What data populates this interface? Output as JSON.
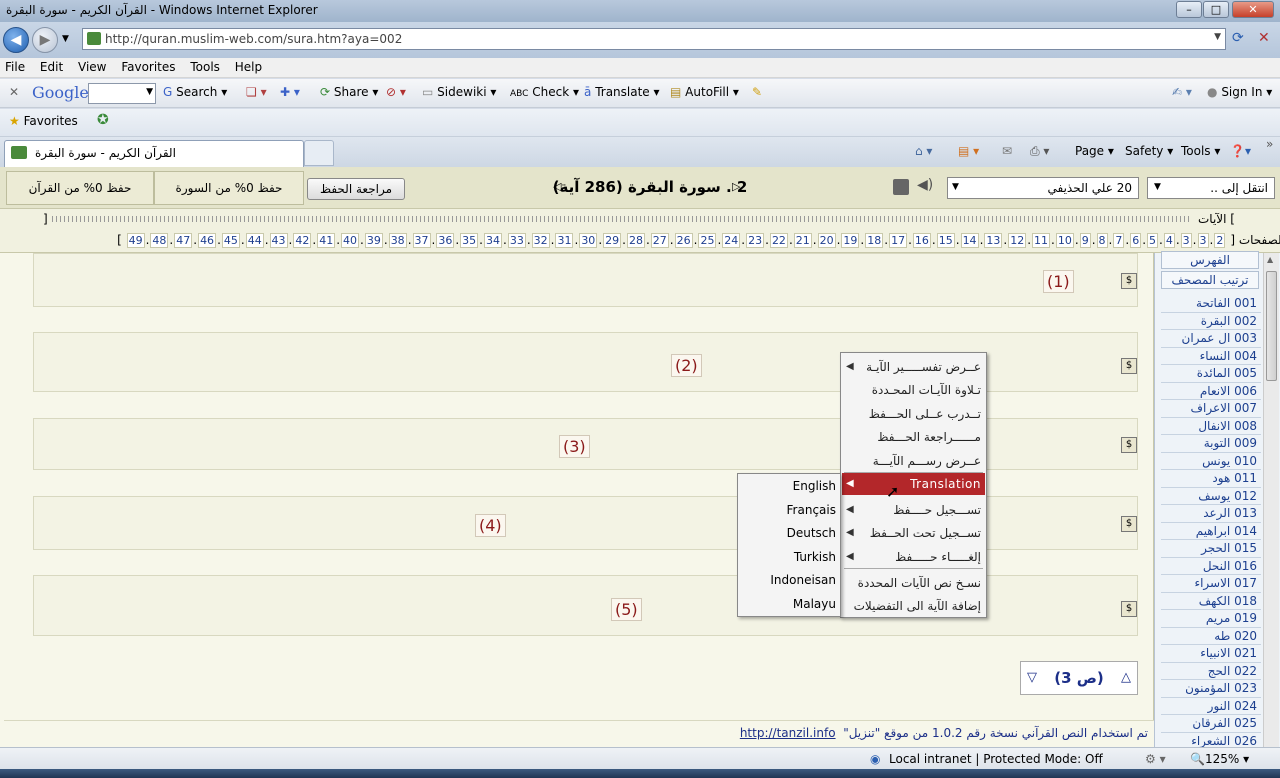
{
  "window": {
    "title": "القرآن الكريم - سورة البقرة - Windows Internet Explorer"
  },
  "browser": {
    "url": "http://quran.muslim-web.com/sura.htm?aya=002",
    "menu": [
      "File",
      "Edit",
      "View",
      "Favorites",
      "Tools",
      "Help"
    ],
    "google_toolbar": {
      "logo": "Google",
      "items": [
        "Search",
        "Share",
        "Sidewiki",
        "Check",
        "Translate",
        "AutoFill",
        "Sign In"
      ]
    },
    "favorites_label": "Favorites",
    "tab_title": "القرآن الكريم - سورة البقرة",
    "commands": [
      "Page",
      "Safety",
      "Tools"
    ]
  },
  "quran": {
    "header": {
      "juz_progress": "حفظ 0% من القرآن",
      "sura_progress": "حفظ 0% من السورة",
      "review_button": "مراجعة الحفظ",
      "sura_title": "2 . سورة البقرة (286 آية)",
      "reciter": "20 علي الحذيفي",
      "goto": "انتقل إلى .."
    },
    "ayat_label": "الآيات [",
    "ayat_end": "]",
    "pages_label": "الصفحات [",
    "pages_end": "]",
    "pages": [
      "2",
      "3",
      "3",
      "4",
      "5",
      "6",
      "7",
      "8",
      "9",
      "10",
      "11",
      "12",
      "13",
      "14",
      "15",
      "16",
      "17",
      "18",
      "19",
      "20",
      "21",
      "22",
      "23",
      "24",
      "25",
      "26",
      "27",
      "28",
      "29",
      "30",
      "31",
      "32",
      "33",
      "34",
      "35",
      "36",
      "37",
      "38",
      "39",
      "40",
      "41",
      "42",
      "43",
      "44",
      "45",
      "46",
      "47",
      "48",
      "49"
    ],
    "ayat": [
      "(1)",
      "(2)",
      "(3)",
      "(4)",
      "(5)"
    ],
    "page_nav": "(ص 3)",
    "footer_text": "تم استخدام النص القرآني نسخة رقم 1.0.2 من موقع \"تنزيل\"",
    "footer_link": "http://tanzil.info"
  },
  "sidebar": {
    "index_button": "الفهرس",
    "order_button": "ترتيب المصحف",
    "suras": [
      "001 الفاتحة",
      "002 البقرة",
      "003 ال عمران",
      "004 النساء",
      "005 المائدة",
      "006 الانعام",
      "007 الاعراف",
      "008 الانفال",
      "009 التوبة",
      "010 يونس",
      "011 هود",
      "012 يوسف",
      "013 الرعد",
      "014 ابراهيم",
      "015 الحجر",
      "016 النحل",
      "017 الاسراء",
      "018 الكهف",
      "019 مريم",
      "020 طه",
      "021 الانبياء",
      "022 الحج",
      "023 المؤمنون",
      "024 النور",
      "025 الفرقان",
      "026 الشعراء"
    ]
  },
  "context_menu": {
    "items": [
      "عــرض تفســـــير الآيـة",
      "تـلاوة الآيـات المحـددة",
      "تــدرب عــلى الحـــفظ",
      "مــــــراجعة الحـــفظ",
      "عــرض رســـم الآيـــة",
      "Translation",
      "تســـجيل حــــفظ",
      "تســجيل تحت الحــفظ",
      "إلغـــــاء حـــــفظ",
      "نسـخ نص الآيات المحددة",
      "إضافة الآية الى التفضيلات"
    ],
    "submenu": [
      "English",
      "Français",
      "Deutsch",
      "Turkish",
      "Indoneisan",
      "Malayu"
    ]
  },
  "status": {
    "zone": "Local intranet | Protected Mode: Off",
    "zoom": "125%"
  }
}
